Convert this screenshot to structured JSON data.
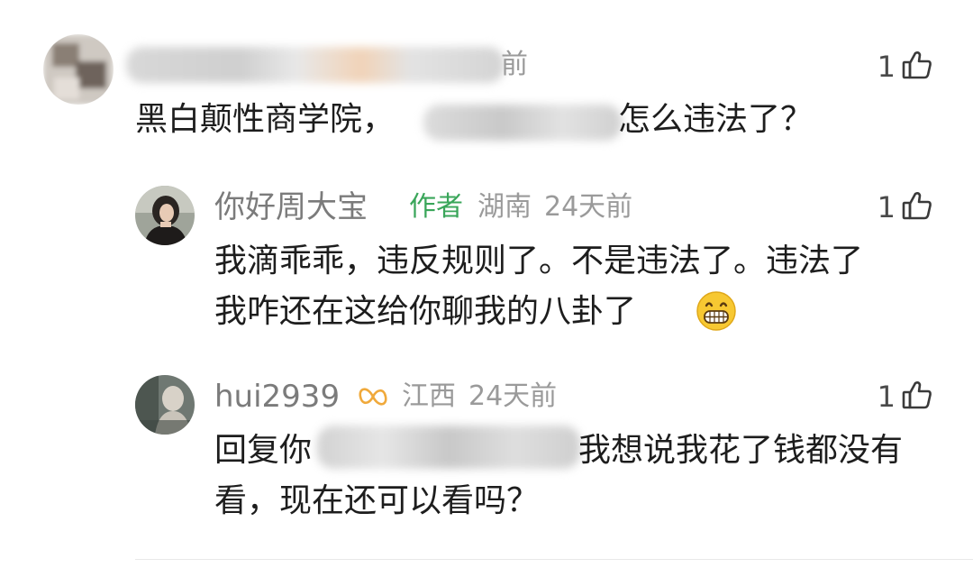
{
  "comments": [
    {
      "name": "",
      "time": "前",
      "text_before_redaction": "黑白颠性商学院，",
      "text_after_redaction": "怎么违法了？",
      "likes": "1"
    },
    {
      "name": "你好周大宝",
      "author_tag": "作者",
      "location": "湖南",
      "time": "24天前",
      "text_line1": "我滴乖乖，违反规则了。不是违法了。违法了",
      "text_line2": "我咋还在这给你聊我的八卦了",
      "likes": "1"
    },
    {
      "name": "hui2939",
      "location": "江西",
      "time": "24天前",
      "text_line1_before_redaction": "回复你",
      "text_line1_after_redaction": "我想说我花了钱都没有",
      "text_line2": "看，现在还可以看吗？",
      "likes": "1"
    }
  ],
  "icons": {
    "like": "thumbs-up-icon",
    "grin": "grinning-emoji-icon",
    "badge": "infinity-badge-icon"
  },
  "colors": {
    "author_tag": "#3aa65a",
    "badge": "#f0a93b"
  }
}
